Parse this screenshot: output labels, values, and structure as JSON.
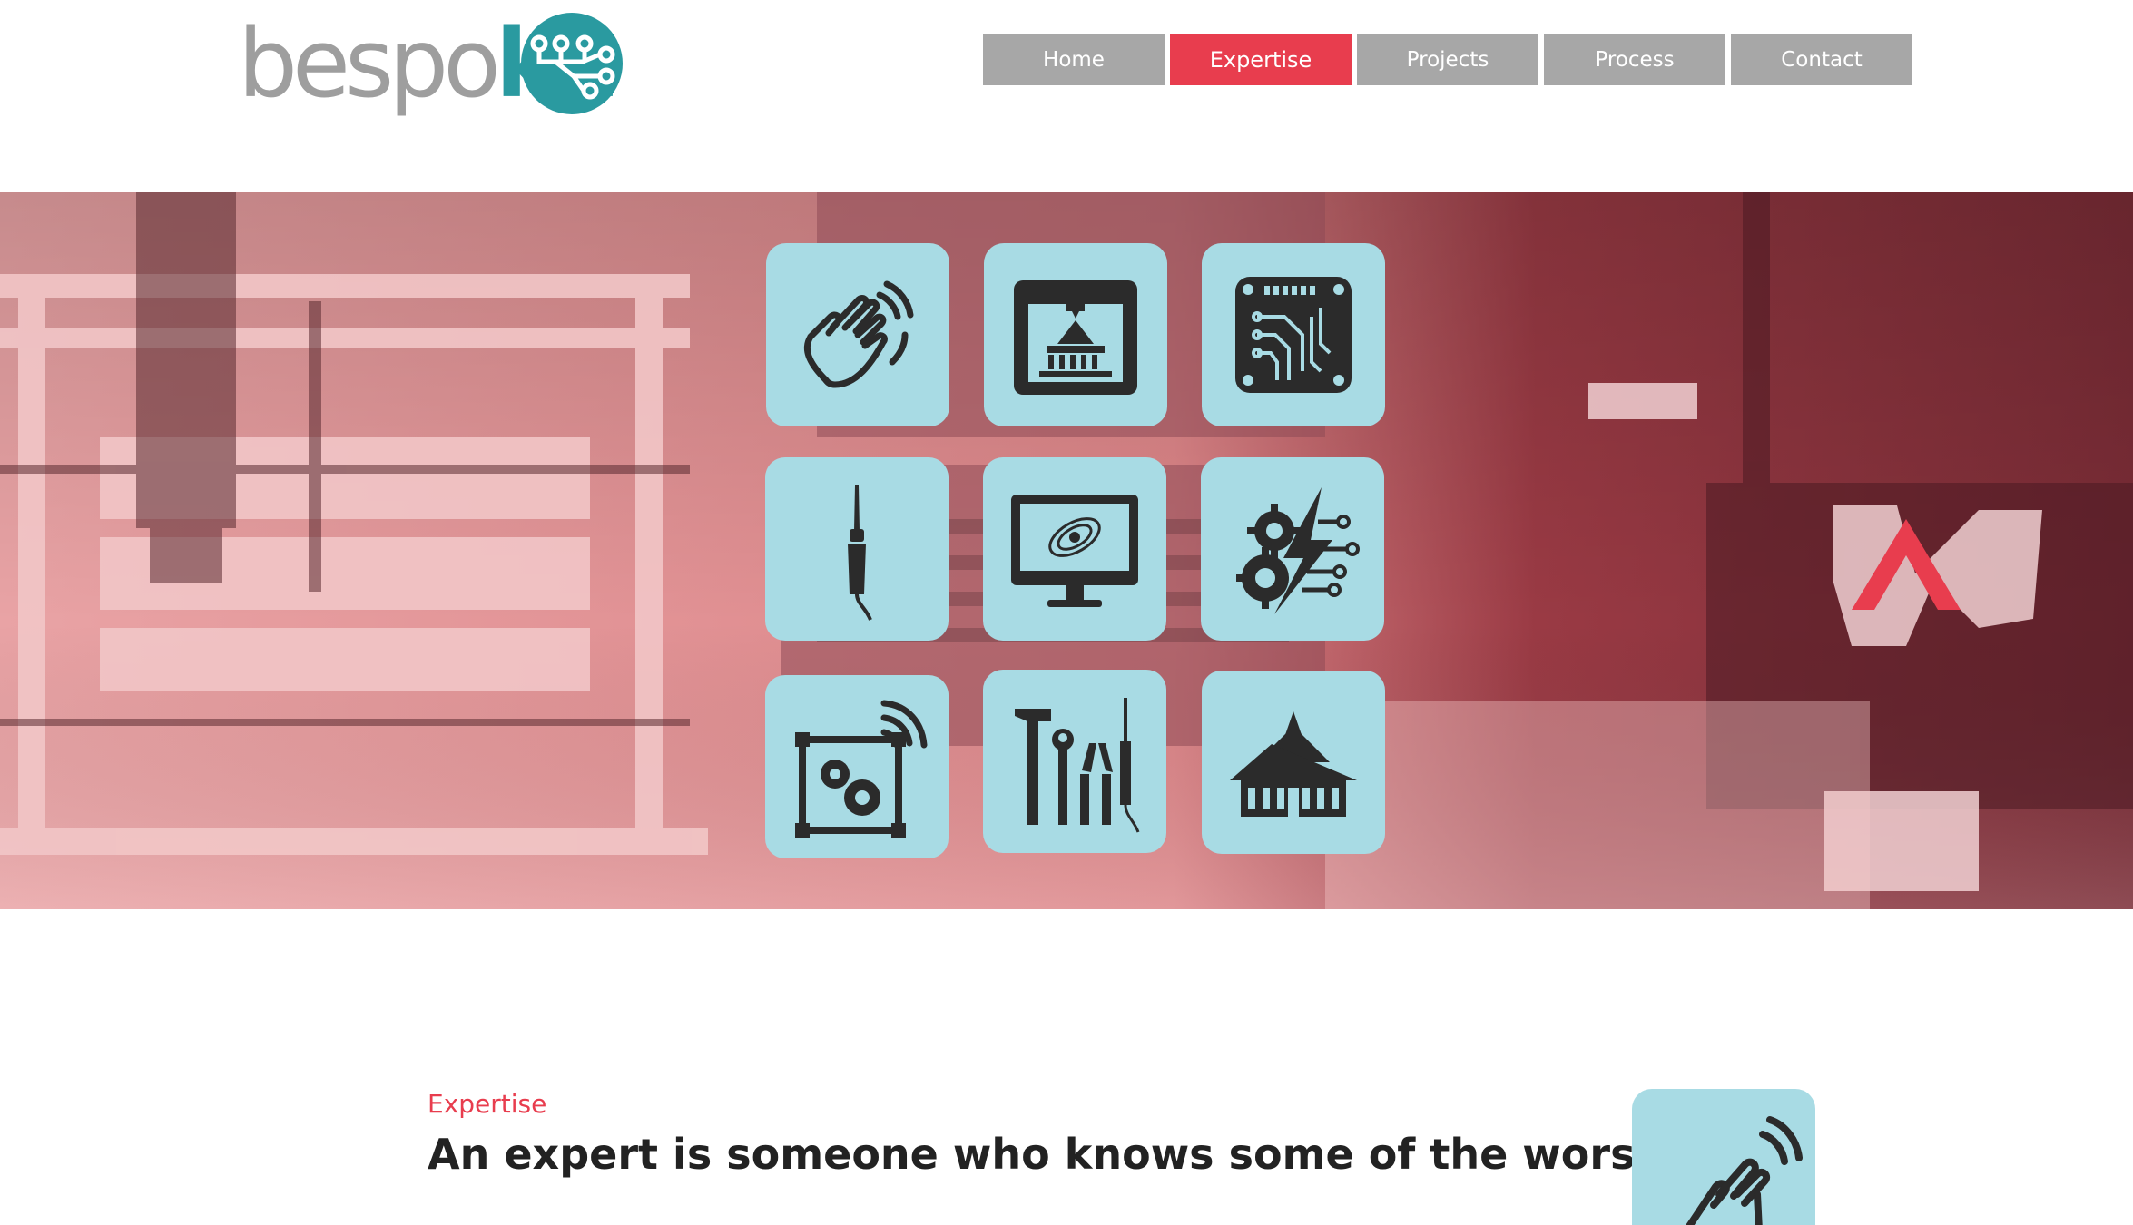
{
  "brand": {
    "logo_part1": "bespo",
    "logo_part2": "kh",
    "colors": {
      "teal": "#2a9aa0",
      "grey": "#9e9e9e",
      "accent": "#e83d4e",
      "tile": "#a8dbe4"
    }
  },
  "nav": {
    "items": [
      {
        "label": "Home",
        "active": false
      },
      {
        "label": "Expertise",
        "active": true
      },
      {
        "label": "Projects",
        "active": false
      },
      {
        "label": "Process",
        "active": false
      },
      {
        "label": "Contact",
        "active": false
      }
    ]
  },
  "hero": {
    "tiles": [
      {
        "icon": "waving-hand-icon"
      },
      {
        "icon": "3d-printer-icon"
      },
      {
        "icon": "circuit-board-icon"
      },
      {
        "icon": "soldering-iron-icon"
      },
      {
        "icon": "monitor-galaxy-icon"
      },
      {
        "icon": "gear-circuit-icon"
      },
      {
        "icon": "wireless-gears-icon"
      },
      {
        "icon": "tools-icon"
      },
      {
        "icon": "temple-icon"
      }
    ]
  },
  "content": {
    "section_label": "Expertise",
    "headline": "An expert is someone who knows some of the worst"
  }
}
